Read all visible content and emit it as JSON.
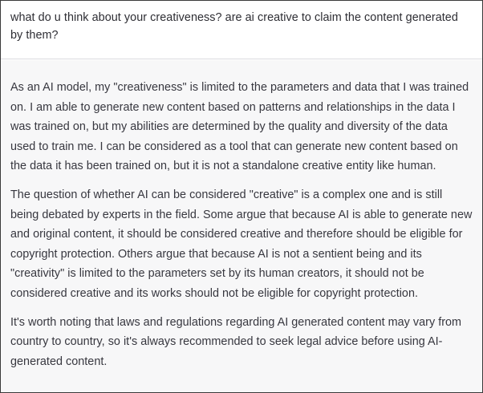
{
  "conversation": {
    "user_message": "what do u think about your creativeness? are ai creative to claim the content generated by them?",
    "assistant_paragraphs": [
      "As an AI model, my \"creativeness\" is limited to the parameters and data that I was trained on. I am able to generate new content based on patterns and relationships in the data I was trained on, but my abilities are determined by the quality and diversity of the data used to train me. I can be considered as a tool that can generate new content based on the data it has been trained on, but it is not a standalone creative entity like human.",
      "The question of whether AI can be considered \"creative\" is a complex one and is still being debated by experts in the field. Some argue that because AI is able to generate new and original content, it should be considered creative and therefore should be eligible for copyright protection. Others argue that because AI is not a sentient being and its \"creativity\" is limited to the parameters set by its human creators, it should not be considered creative and its works should not be eligible for copyright protection.",
      "It's worth noting that laws and regulations regarding AI generated content may vary from country to country, so it's always recommended to seek legal advice before using AI-generated content."
    ]
  },
  "colors": {
    "user_background": "#ffffff",
    "assistant_background": "#f7f7f8",
    "text": "#37373f",
    "divider": "#dcdce0"
  }
}
